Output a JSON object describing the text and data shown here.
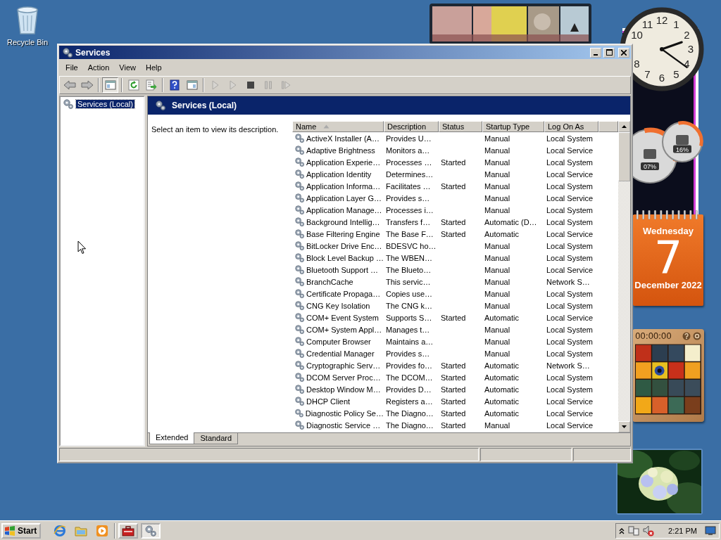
{
  "desktop": {
    "icons": [
      {
        "label": "Recycle Bin"
      }
    ]
  },
  "gadgets": {
    "clock": {
      "numerals": [
        "12",
        "1",
        "2",
        "3",
        "4",
        "5",
        "6",
        "7",
        "8",
        "10",
        "11"
      ]
    },
    "cpu_meter": {
      "dials": [
        {
          "reading": "07%"
        },
        {
          "reading": "16%"
        }
      ]
    },
    "calendar": {
      "weekday": "Wednesday",
      "day": "7",
      "month_year": "December 2022"
    },
    "puzzle": {
      "timer": "00:00:00"
    }
  },
  "window": {
    "title": "Services",
    "menu": [
      "File",
      "Action",
      "View",
      "Help"
    ],
    "toolbar": [
      [
        {
          "kind": "back",
          "disabled": false,
          "pressed": false
        },
        {
          "kind": "forward",
          "disabled": false,
          "pressed": false
        }
      ],
      [
        {
          "kind": "tree",
          "disabled": false,
          "pressed": true
        }
      ],
      [
        {
          "kind": "refresh",
          "disabled": false,
          "pressed": false
        },
        {
          "kind": "export",
          "disabled": false,
          "pressed": false
        }
      ],
      [
        {
          "kind": "help",
          "disabled": false,
          "pressed": false
        },
        {
          "kind": "properties",
          "disabled": false,
          "pressed": false
        }
      ],
      [
        {
          "kind": "play",
          "disabled": true,
          "pressed": false
        },
        {
          "kind": "play",
          "disabled": true,
          "pressed": false
        },
        {
          "kind": "stop",
          "disabled": false,
          "pressed": false
        },
        {
          "kind": "pause",
          "disabled": true,
          "pressed": false
        },
        {
          "kind": "resume",
          "disabled": true,
          "pressed": false
        }
      ]
    ],
    "tree": [
      {
        "label": "Services (Local)",
        "selected": true
      }
    ],
    "pane_title": "Services (Local)",
    "description_hint": "Select an item to view its description.",
    "table": {
      "columns": [
        {
          "label": "Name",
          "sorted": true
        },
        {
          "label": "Description",
          "sorted": false
        },
        {
          "label": "Status",
          "sorted": false
        },
        {
          "label": "Startup Type",
          "sorted": false
        },
        {
          "label": "Log On As",
          "sorted": false
        }
      ],
      "rows": [
        {
          "name": "ActiveX Installer (A…",
          "description": "Provides U…",
          "startup_type": "Manual",
          "log_on_as": "Local System"
        },
        {
          "name": "Adaptive Brightness",
          "description": "Monitors a…",
          "startup_type": "Manual",
          "log_on_as": "Local Service"
        },
        {
          "name": "Application Experie…",
          "description": "Processes …",
          "status": "Started",
          "startup_type": "Manual",
          "log_on_as": "Local System"
        },
        {
          "name": "Application Identity",
          "description": "Determines…",
          "startup_type": "Manual",
          "log_on_as": "Local Service"
        },
        {
          "name": "Application Informa…",
          "description": "Facilitates …",
          "status": "Started",
          "startup_type": "Manual",
          "log_on_as": "Local System"
        },
        {
          "name": "Application Layer G…",
          "description": "Provides s…",
          "startup_type": "Manual",
          "log_on_as": "Local Service"
        },
        {
          "name": "Application Manage…",
          "description": "Processes i…",
          "startup_type": "Manual",
          "log_on_as": "Local System"
        },
        {
          "name": "Background Intellig…",
          "description": "Transfers f…",
          "status": "Started",
          "startup_type": "Automatic (D…",
          "log_on_as": "Local System"
        },
        {
          "name": "Base Filtering Engine",
          "description": "The Base F…",
          "status": "Started",
          "startup_type": "Automatic",
          "log_on_as": "Local Service"
        },
        {
          "name": "BitLocker Drive Enc…",
          "description": "BDESVC ho…",
          "startup_type": "Manual",
          "log_on_as": "Local System"
        },
        {
          "name": "Block Level Backup …",
          "description": "The WBEN…",
          "startup_type": "Manual",
          "log_on_as": "Local System"
        },
        {
          "name": "Bluetooth Support …",
          "description": "The Blueto…",
          "startup_type": "Manual",
          "log_on_as": "Local Service"
        },
        {
          "name": "BranchCache",
          "description": "This servic…",
          "startup_type": "Manual",
          "log_on_as": "Network S…"
        },
        {
          "name": "Certificate Propaga…",
          "description": "Copies use…",
          "startup_type": "Manual",
          "log_on_as": "Local System"
        },
        {
          "name": "CNG Key Isolation",
          "description": "The CNG k…",
          "startup_type": "Manual",
          "log_on_as": "Local System"
        },
        {
          "name": "COM+ Event System",
          "description": "Supports S…",
          "status": "Started",
          "startup_type": "Automatic",
          "log_on_as": "Local Service"
        },
        {
          "name": "COM+ System Appl…",
          "description": "Manages t…",
          "startup_type": "Manual",
          "log_on_as": "Local System"
        },
        {
          "name": "Computer Browser",
          "description": "Maintains a…",
          "startup_type": "Manual",
          "log_on_as": "Local System"
        },
        {
          "name": "Credential Manager",
          "description": "Provides s…",
          "startup_type": "Manual",
          "log_on_as": "Local System"
        },
        {
          "name": "Cryptographic Serv…",
          "description": "Provides fo…",
          "status": "Started",
          "startup_type": "Automatic",
          "log_on_as": "Network S…"
        },
        {
          "name": "DCOM Server Proc…",
          "description": "The DCOM…",
          "status": "Started",
          "startup_type": "Automatic",
          "log_on_as": "Local System"
        },
        {
          "name": "Desktop Window M…",
          "description": "Provides D…",
          "status": "Started",
          "startup_type": "Automatic",
          "log_on_as": "Local System"
        },
        {
          "name": "DHCP Client",
          "description": "Registers a…",
          "status": "Started",
          "startup_type": "Automatic",
          "log_on_as": "Local Service"
        },
        {
          "name": "Diagnostic Policy Se…",
          "description": "The Diagno…",
          "status": "Started",
          "startup_type": "Automatic",
          "log_on_as": "Local Service"
        },
        {
          "name": "Diagnostic Service …",
          "description": "The Diagno…",
          "status": "Started",
          "startup_type": "Manual",
          "log_on_as": "Local Service"
        }
      ]
    },
    "tabs": [
      {
        "label": "Extended",
        "selected": true
      },
      {
        "label": "Standard",
        "selected": false
      }
    ]
  },
  "taskbar": {
    "start": "Start",
    "quick_launch": [
      {
        "kind": "browser"
      },
      {
        "kind": "folder"
      },
      {
        "kind": "media"
      }
    ],
    "apps": [
      {
        "kind": "toolbox",
        "selected": false
      },
      {
        "kind": "services",
        "selected": true
      }
    ],
    "clock": "2:21 PM"
  }
}
